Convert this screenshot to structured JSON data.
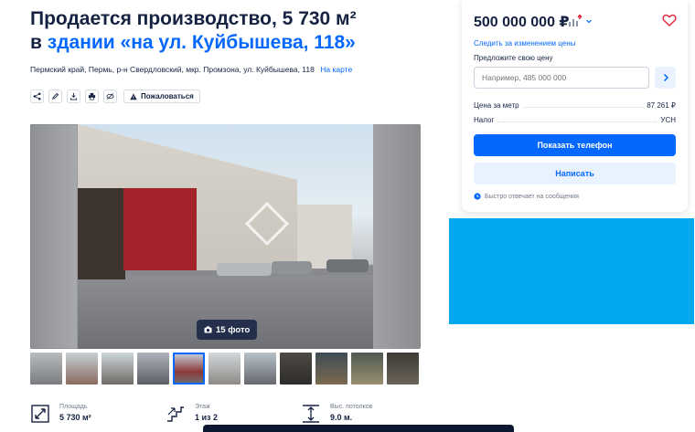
{
  "listing": {
    "title_line1": "Продается производство, 5 730 м²",
    "title_prefix": "в ",
    "title_link": "здании «на ул. Куйбышева, 118»",
    "address": "Пермский край, Пермь, р-н Свердловский, мкр. Промзона, ул. Куйбышева, 118",
    "map_link": "На карте",
    "complain_label": "Пожаловаться",
    "photo_count": "15 фото"
  },
  "action_icons": [
    "share-icon",
    "edit-icon",
    "download-icon",
    "print-icon",
    "hide-icon"
  ],
  "facts": [
    {
      "icon": "area-icon",
      "label": "Площадь",
      "value": "5 730 м²"
    },
    {
      "icon": "stairs-icon",
      "label": "Этаж",
      "value": "1 из 2"
    },
    {
      "icon": "ceiling-height-icon",
      "label": "Выс. потолков",
      "value": "9.0 м."
    }
  ],
  "sidebar": {
    "price": "500 000 000 ₽",
    "follow_price": "Следить за изменением цены",
    "offer_label": "Предложите свою цену",
    "offer_placeholder": "Например, 485 000 000",
    "price_per_meter_label": "Цена за метр",
    "price_per_meter_value": "87 261 ₽",
    "tax_label": "Налог",
    "tax_value": "УСН",
    "phone_button": "Показать телефон",
    "write_button": "Написать",
    "reply_note": "Быстро отвечает на сообщения"
  },
  "colors": {
    "accent": "#0468ff",
    "text": "#152242",
    "banner": "#00a8f0"
  }
}
